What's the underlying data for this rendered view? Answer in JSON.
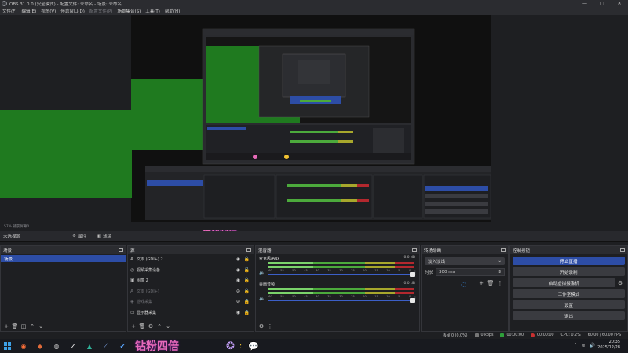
{
  "window": {
    "title": "OBS 31.0.0 (安全模式) - 配置文件: 未命名 - 场景: 未命名",
    "controls": [
      "—",
      "▢",
      "✕"
    ]
  },
  "menu": [
    {
      "label": "文件(F)",
      "enabled": true
    },
    {
      "label": "编辑(E)",
      "enabled": true
    },
    {
      "label": "视图(V)",
      "enabled": true
    },
    {
      "label": "停靠窗口(D)",
      "enabled": true
    },
    {
      "label": "配置文件(P)",
      "enabled": false
    },
    {
      "label": "场景集合(S)",
      "enabled": true
    },
    {
      "label": "工具(T)",
      "enabled": true
    },
    {
      "label": "帮助(H)",
      "enabled": true
    }
  ],
  "preview": {
    "status": "57%  捕获屏幕0"
  },
  "scene_toolbar": {
    "no_source": "未选择源",
    "properties": "属性",
    "filters": "滤镜"
  },
  "scenes": {
    "title": "场景",
    "items": [
      "场景"
    ]
  },
  "sources": {
    "title": "源",
    "items": [
      {
        "icon": "text-icon",
        "glyph": "A",
        "name": "文本 (GDI+) 2",
        "visible": true,
        "locked": false
      },
      {
        "icon": "camera-icon",
        "glyph": "◎",
        "name": "视频采集设备",
        "visible": true,
        "locked": false
      },
      {
        "icon": "image-icon",
        "glyph": "▣",
        "name": "图像 2",
        "visible": true,
        "locked": false
      },
      {
        "icon": "text-icon",
        "glyph": "A",
        "name": "文本 (GDI+)",
        "visible": false,
        "locked": false
      },
      {
        "icon": "game-capture-icon",
        "glyph": "◈",
        "name": "游戏采集",
        "visible": false,
        "locked": true
      },
      {
        "icon": "display-capture-icon",
        "glyph": "▭",
        "name": "显示器采集",
        "visible": true,
        "locked": true
      }
    ]
  },
  "mixer": {
    "title": "混音器",
    "channels": [
      {
        "name": "麦克风/Aux",
        "db": "0.0 dB"
      },
      {
        "name": "桌面音频",
        "db": "0.0 dB"
      }
    ],
    "scale": [
      "-60",
      "-55",
      "-50",
      "-45",
      "-40",
      "-35",
      "-30",
      "-25",
      "-20",
      "-15",
      "-10",
      "-5",
      "0"
    ]
  },
  "transitions": {
    "title": "转场动画",
    "selected": "淡入淡出",
    "duration_label": "时长",
    "duration": "300 ms"
  },
  "controls": {
    "title": "控制按钮",
    "stop_stream": "停止直播",
    "start_record": "开始录制",
    "virtual_cam": "启动虚拟摄像机",
    "studio_mode": "工作室模式",
    "settings": "设置",
    "exit": "退出"
  },
  "statusbar": {
    "dropped": "丢帧 0 (0.0%)",
    "kbps": "0 kbps",
    "stream_time": "00:00:00",
    "rec_time": "00:00:00",
    "cpu": "CPU: 0.2%",
    "fps": "60.00 / 60.00 FPS"
  },
  "taskbar": {
    "big_text": "钻粉四倍",
    "time": "20:35",
    "date": "2025/12/28",
    "icons": [
      {
        "name": "firefox-icon",
        "glyph": "◉",
        "color": "#ff7139"
      },
      {
        "name": "app-diamond-icon",
        "glyph": "◆",
        "color": "#e06b3a"
      },
      {
        "name": "obs-icon",
        "glyph": "◍",
        "color": "#d0d0d0"
      },
      {
        "name": "z-app-icon",
        "glyph": "Z",
        "color": "#f0f0f0"
      },
      {
        "name": "triangle-app-icon",
        "glyph": "▲",
        "color": "#2fb39a"
      },
      {
        "name": "slash-app-icon",
        "glyph": "⟋",
        "color": "#8ab4ff"
      },
      {
        "name": "check-app-icon",
        "glyph": "✔",
        "color": "#59a6ff"
      }
    ]
  },
  "colors": {
    "accent": "#2d4da6",
    "green_fill": "#1f7a1f",
    "meter_green": "#4caa3c",
    "meter_yellow": "#a7a72c",
    "meter_red": "#b3282e"
  }
}
